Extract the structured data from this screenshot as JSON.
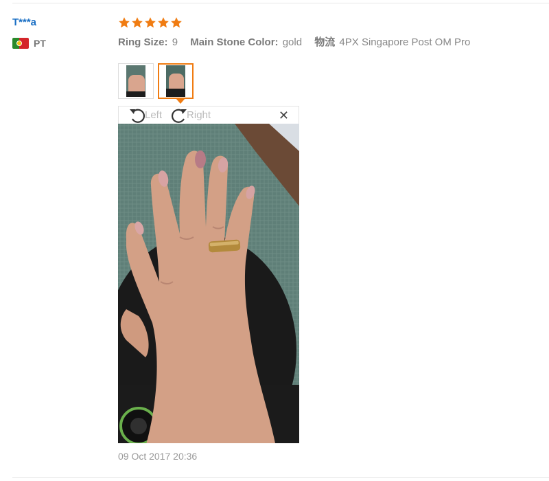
{
  "buyer": {
    "name": "T***a",
    "country_code": "PT",
    "flag_icon": "portugal-flag-icon"
  },
  "review": {
    "rating": 5,
    "star_color": "#f07c12",
    "attributes": [
      {
        "label": "Ring Size:",
        "value": "9"
      },
      {
        "label": "Main Stone Color:",
        "value": "gold"
      },
      {
        "label": "物流",
        "value": "4PX Singapore Post OM Pro"
      }
    ],
    "thumbnails": [
      {
        "name": "thumbnail-1",
        "active": false
      },
      {
        "name": "thumbnail-2",
        "active": true
      }
    ],
    "viewer": {
      "rotate_left_label": "Left",
      "rotate_right_label": "Right",
      "close_icon": "close-icon",
      "rotate_left_icon": "rotate-left-icon",
      "rotate_right_icon": "rotate-right-icon"
    },
    "date": "09 Oct 2017 20:36"
  }
}
